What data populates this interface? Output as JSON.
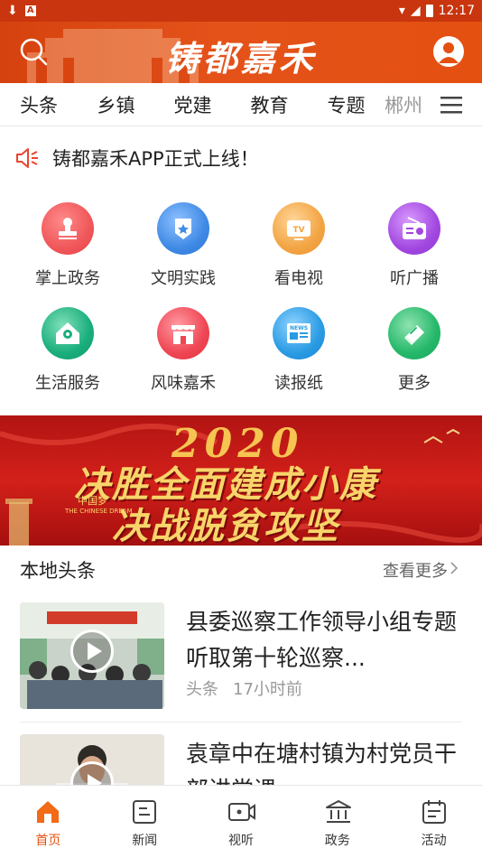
{
  "status_bar": {
    "time": "12:17"
  },
  "header": {
    "logo_text": "铸都嘉禾"
  },
  "tabs": [
    "头条",
    "乡镇",
    "党建",
    "教育",
    "专题",
    "郴州"
  ],
  "notice": {
    "text": "铸都嘉禾APP正式上线！"
  },
  "services": [
    {
      "label": "掌上政务",
      "icon": "stamp-icon",
      "color": "#f0575a"
    },
    {
      "label": "文明实践",
      "icon": "badge-star-icon",
      "color": "#3f8ae5"
    },
    {
      "label": "看电视",
      "icon": "tv-icon",
      "color": "#f2a443"
    },
    {
      "label": "听广播",
      "icon": "radio-icon",
      "color": "#a248e0"
    },
    {
      "label": "生活服务",
      "icon": "home-location-icon",
      "color": "#1aae7c"
    },
    {
      "label": "风味嘉禾",
      "icon": "shop-icon",
      "color": "#ef4654"
    },
    {
      "label": "读报纸",
      "icon": "newspaper-icon",
      "color": "#2a9be3"
    },
    {
      "label": "更多",
      "icon": "books-icon",
      "color": "#25b86a"
    }
  ],
  "banner": {
    "year": "2020",
    "line1": "决胜全面建成小康",
    "line2": "决战脱贫攻坚",
    "small1": "中国梦",
    "small2": "THE CHINESE DREAM"
  },
  "section": {
    "title": "本地头条",
    "more": "查看更多"
  },
  "news": [
    {
      "headline": "县委巡察工作领导小组专题听取第十轮巡察...",
      "category": "头条",
      "time": "17小时前"
    },
    {
      "headline": "袁章中在塘村镇为村党员干部讲党课"
    }
  ],
  "bottom_nav": [
    {
      "label": "首页",
      "icon": "home-icon",
      "active": true
    },
    {
      "label": "新闻",
      "icon": "news-icon",
      "active": false
    },
    {
      "label": "视听",
      "icon": "video-icon",
      "active": false
    },
    {
      "label": "政务",
      "icon": "government-icon",
      "active": false
    },
    {
      "label": "活动",
      "icon": "calendar-icon",
      "active": false
    }
  ],
  "colors": {
    "brand": "#e45010",
    "header_dark": "#c8350e",
    "banner_red": "#c81d18",
    "banner_gold": "#f8d56a"
  }
}
